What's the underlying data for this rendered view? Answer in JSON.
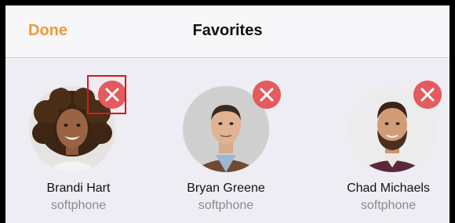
{
  "navbar": {
    "done_label": "Done",
    "title": "Favorites"
  },
  "colors": {
    "accent": "#ee9a3a",
    "remove": "#e35b5e",
    "background": "#eeedf3",
    "highlight": "#d9191a"
  },
  "contacts": [
    {
      "name": "Brandi Hart",
      "type": "softphone",
      "avatar_icon": "woman-portrait-icon",
      "remove_icon": "remove-icon"
    },
    {
      "name": "Bryan Greene",
      "type": "softphone",
      "avatar_icon": "man-portrait-icon",
      "remove_icon": "remove-icon"
    },
    {
      "name": "Chad Michaels",
      "type": "softphone",
      "avatar_icon": "bearded-man-portrait-icon",
      "remove_icon": "remove-icon"
    }
  ]
}
